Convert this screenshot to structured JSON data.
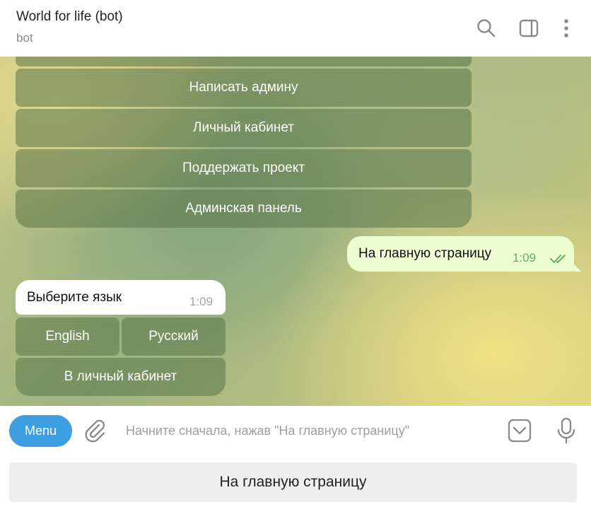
{
  "header": {
    "title": "World for life (bot)",
    "subtitle": "bot",
    "icons": [
      "search-icon",
      "sidebar-toggle-icon",
      "more-vertical-icon"
    ]
  },
  "chat": {
    "top_keyboard": [
      "Написать админу",
      "Личный кабинет",
      "Поддержать проект",
      "Админская панель"
    ],
    "outgoing_message": {
      "text": "На главную страницу",
      "time": "1:09",
      "status_icon": "double-check-icon"
    },
    "incoming_message": {
      "text": "Выберите язык",
      "time": "1:09"
    },
    "language_keyboard": {
      "row1": [
        "English",
        "Русский"
      ],
      "row2": "В личный кабинет"
    }
  },
  "input": {
    "menu_label": "Menu",
    "placeholder": "Начните сначала, нажав \"На главную страницу\"",
    "value": "",
    "icons": [
      "paperclip-icon",
      "keyboard-toggle-icon",
      "microphone-icon"
    ]
  },
  "reply_keyboard": {
    "button_label": "На главную страницу"
  },
  "colors": {
    "accent": "#3d9fe2",
    "outgoing_bubble": "#eefed3",
    "check_green": "#6aad5c",
    "inline_button": "#5a7548"
  }
}
